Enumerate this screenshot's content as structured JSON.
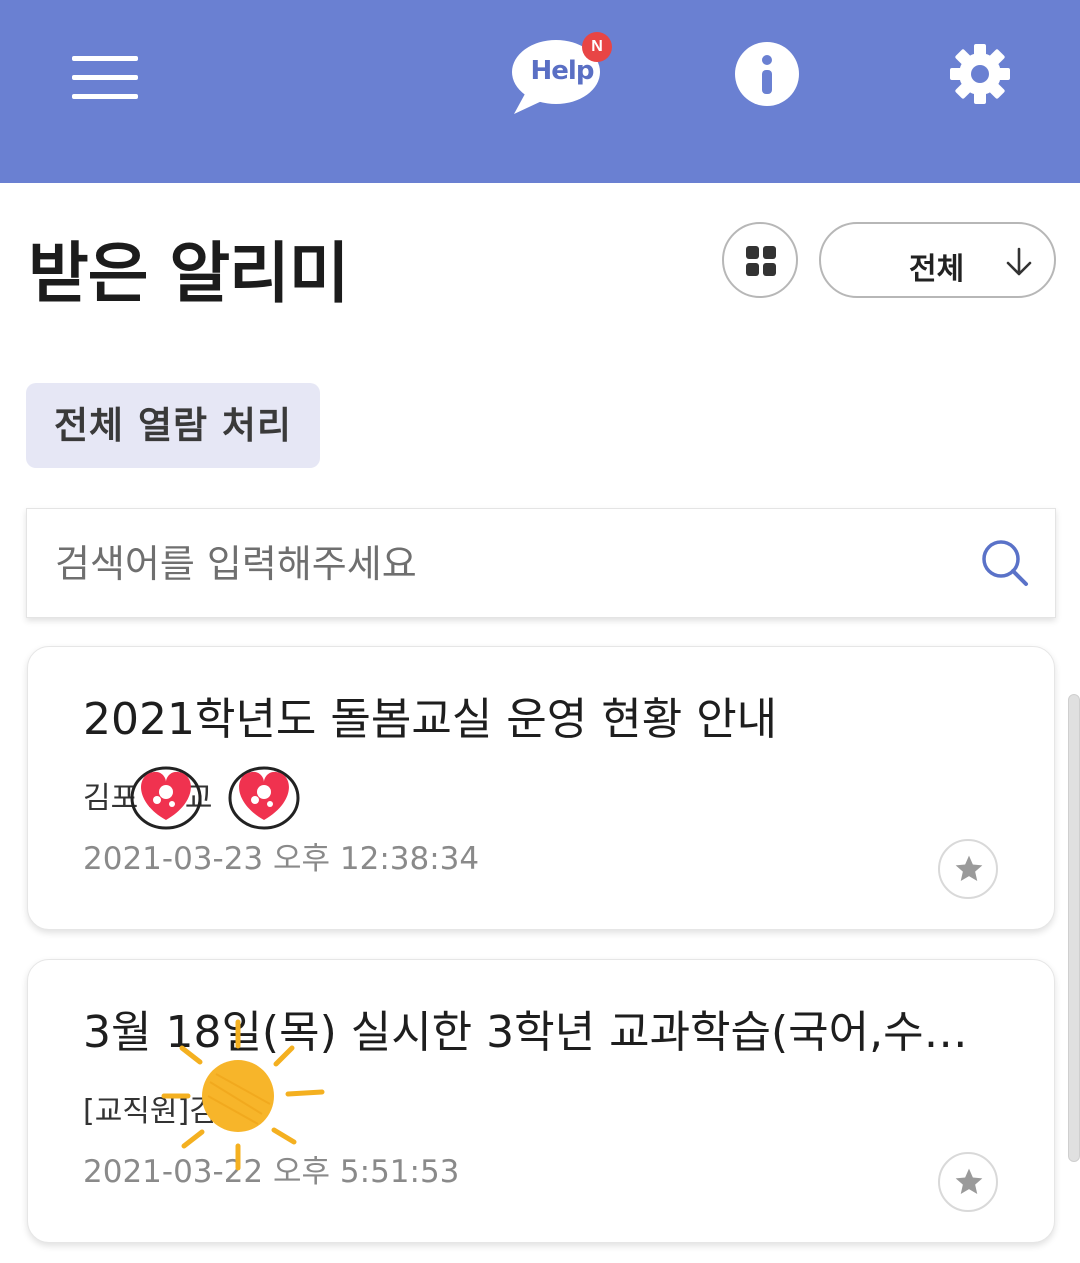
{
  "header": {
    "help_label": "Help",
    "help_badge": "N",
    "background_color": "#6a80d2",
    "icons": [
      "hamburger-icon",
      "help-speech-icon",
      "info-icon",
      "gear-icon"
    ]
  },
  "page": {
    "title": "받은 알리미",
    "filter_label": "전체",
    "mark_all_label": "전체 열람 처리"
  },
  "search": {
    "placeholder": "검색어를 입력해주세요",
    "value": ""
  },
  "notices": [
    {
      "title": "2021학년도 돌봄교실 운영 현황 안내",
      "sender": "김포 초 교",
      "date": "2021-03-23 오후 12:38:34"
    },
    {
      "title": "3월 18일(목) 실시한 3학년 교과학습(국어,수…",
      "sender": "[교직원]김",
      "date": "2021-03-22 오후 5:51:53"
    }
  ]
}
